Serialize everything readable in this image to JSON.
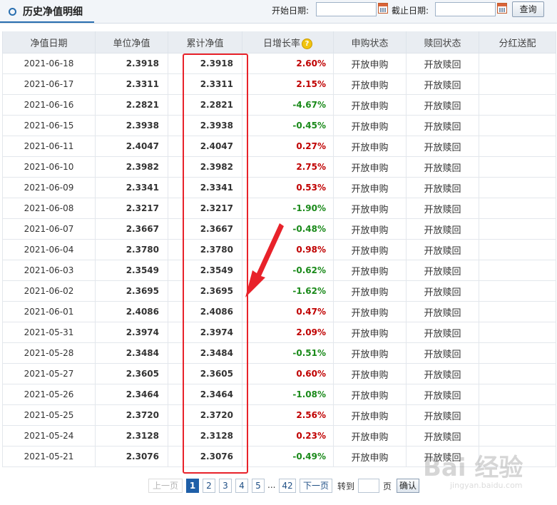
{
  "header": {
    "title": "历史净值明细",
    "start_date_label": "开始日期:",
    "end_date_label": "截止日期:",
    "start_date_value": "",
    "end_date_value": "",
    "query_label": "查询"
  },
  "table": {
    "columns": [
      "净值日期",
      "单位净值",
      "累计净值",
      "日增长率",
      "申购状态",
      "赎回状态",
      "分红送配"
    ],
    "rows": [
      {
        "date": "2021-06-18",
        "nav": "2.3918",
        "acc": "2.3918",
        "growth": "2.60%",
        "dir": "up",
        "buy": "开放申购",
        "redeem": "开放赎回",
        "div": ""
      },
      {
        "date": "2021-06-17",
        "nav": "2.3311",
        "acc": "2.3311",
        "growth": "2.15%",
        "dir": "up",
        "buy": "开放申购",
        "redeem": "开放赎回",
        "div": ""
      },
      {
        "date": "2021-06-16",
        "nav": "2.2821",
        "acc": "2.2821",
        "growth": "-4.67%",
        "dir": "down",
        "buy": "开放申购",
        "redeem": "开放赎回",
        "div": ""
      },
      {
        "date": "2021-06-15",
        "nav": "2.3938",
        "acc": "2.3938",
        "growth": "-0.45%",
        "dir": "down",
        "buy": "开放申购",
        "redeem": "开放赎回",
        "div": ""
      },
      {
        "date": "2021-06-11",
        "nav": "2.4047",
        "acc": "2.4047",
        "growth": "0.27%",
        "dir": "up",
        "buy": "开放申购",
        "redeem": "开放赎回",
        "div": ""
      },
      {
        "date": "2021-06-10",
        "nav": "2.3982",
        "acc": "2.3982",
        "growth": "2.75%",
        "dir": "up",
        "buy": "开放申购",
        "redeem": "开放赎回",
        "div": ""
      },
      {
        "date": "2021-06-09",
        "nav": "2.3341",
        "acc": "2.3341",
        "growth": "0.53%",
        "dir": "up",
        "buy": "开放申购",
        "redeem": "开放赎回",
        "div": ""
      },
      {
        "date": "2021-06-08",
        "nav": "2.3217",
        "acc": "2.3217",
        "growth": "-1.90%",
        "dir": "down",
        "buy": "开放申购",
        "redeem": "开放赎回",
        "div": ""
      },
      {
        "date": "2021-06-07",
        "nav": "2.3667",
        "acc": "2.3667",
        "growth": "-0.48%",
        "dir": "down",
        "buy": "开放申购",
        "redeem": "开放赎回",
        "div": ""
      },
      {
        "date": "2021-06-04",
        "nav": "2.3780",
        "acc": "2.3780",
        "growth": "0.98%",
        "dir": "up",
        "buy": "开放申购",
        "redeem": "开放赎回",
        "div": ""
      },
      {
        "date": "2021-06-03",
        "nav": "2.3549",
        "acc": "2.3549",
        "growth": "-0.62%",
        "dir": "down",
        "buy": "开放申购",
        "redeem": "开放赎回",
        "div": ""
      },
      {
        "date": "2021-06-02",
        "nav": "2.3695",
        "acc": "2.3695",
        "growth": "-1.62%",
        "dir": "down",
        "buy": "开放申购",
        "redeem": "开放赎回",
        "div": ""
      },
      {
        "date": "2021-06-01",
        "nav": "2.4086",
        "acc": "2.4086",
        "growth": "0.47%",
        "dir": "up",
        "buy": "开放申购",
        "redeem": "开放赎回",
        "div": ""
      },
      {
        "date": "2021-05-31",
        "nav": "2.3974",
        "acc": "2.3974",
        "growth": "2.09%",
        "dir": "up",
        "buy": "开放申购",
        "redeem": "开放赎回",
        "div": ""
      },
      {
        "date": "2021-05-28",
        "nav": "2.3484",
        "acc": "2.3484",
        "growth": "-0.51%",
        "dir": "down",
        "buy": "开放申购",
        "redeem": "开放赎回",
        "div": ""
      },
      {
        "date": "2021-05-27",
        "nav": "2.3605",
        "acc": "2.3605",
        "growth": "0.60%",
        "dir": "up",
        "buy": "开放申购",
        "redeem": "开放赎回",
        "div": ""
      },
      {
        "date": "2021-05-26",
        "nav": "2.3464",
        "acc": "2.3464",
        "growth": "-1.08%",
        "dir": "down",
        "buy": "开放申购",
        "redeem": "开放赎回",
        "div": ""
      },
      {
        "date": "2021-05-25",
        "nav": "2.3720",
        "acc": "2.3720",
        "growth": "2.56%",
        "dir": "up",
        "buy": "开放申购",
        "redeem": "开放赎回",
        "div": ""
      },
      {
        "date": "2021-05-24",
        "nav": "2.3128",
        "acc": "2.3128",
        "growth": "0.23%",
        "dir": "up",
        "buy": "开放申购",
        "redeem": "开放赎回",
        "div": ""
      },
      {
        "date": "2021-05-21",
        "nav": "2.3076",
        "acc": "2.3076",
        "growth": "-0.49%",
        "dir": "down",
        "buy": "开放申购",
        "redeem": "开放赎回",
        "div": ""
      }
    ]
  },
  "pagination": {
    "prev_label": "上一页",
    "pages": [
      "1",
      "2",
      "3",
      "4",
      "5"
    ],
    "current_page": "1",
    "ellipsis": "...",
    "last_page": "42",
    "next_label": "下一页",
    "goto_label": "转到",
    "page_unit": "页",
    "confirm_label": "确认"
  },
  "watermark": {
    "logo": "Bai 经验",
    "url": "jingyan.baidu.com"
  },
  "colors": {
    "up": "#c00000",
    "down": "#1a8a1a",
    "highlight": "#e8222a",
    "accent": "#2a6fb0"
  },
  "icons": {
    "section": "circle-icon",
    "calendar": "calendar-icon",
    "help": "question-icon",
    "arrow": "annotation-arrow-icon"
  }
}
